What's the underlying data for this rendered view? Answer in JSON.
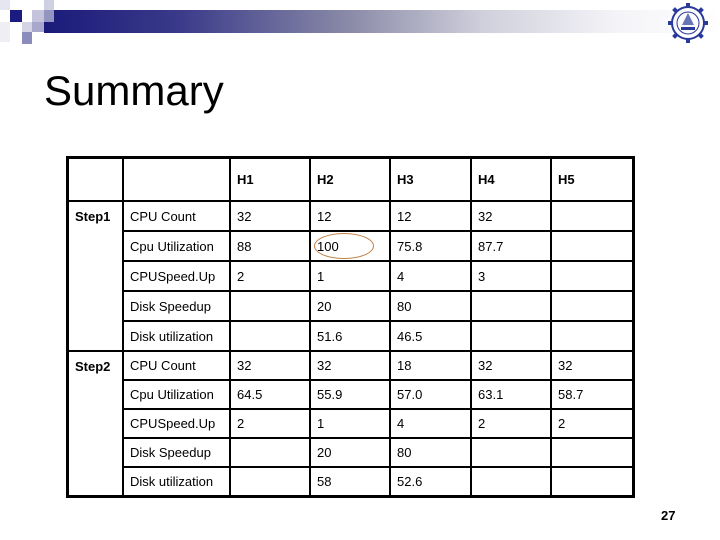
{
  "slide": {
    "title": "Summary",
    "page_number": "27",
    "logo": "institute-emblem-icon",
    "accent_color": "#1a1a7a"
  },
  "table": {
    "headers": [
      "",
      "",
      "H1",
      "H2",
      "H3",
      "H4",
      "H5"
    ],
    "groups": [
      {
        "label": "Step1",
        "rows": [
          {
            "metric": "CPU Count",
            "values": [
              "32",
              "12",
              "12",
              "32",
              ""
            ]
          },
          {
            "metric": "Cpu Utilization",
            "values": [
              "88",
              "100",
              "75.8",
              "87.7",
              ""
            ],
            "highlighted": "H2"
          },
          {
            "metric": "CPUSpeed.Up",
            "values": [
              "2",
              "1",
              "4",
              "3",
              ""
            ]
          },
          {
            "metric": "Disk Speedup",
            "values": [
              "",
              "20",
              "80",
              "",
              ""
            ]
          },
          {
            "metric": "Disk utilization",
            "values": [
              "",
              "51.6",
              "46.5",
              "",
              ""
            ]
          }
        ]
      },
      {
        "label": "Step2",
        "rows": [
          {
            "metric": "CPU Count",
            "values": [
              "32",
              "32",
              "18",
              "32",
              "32"
            ]
          },
          {
            "metric": "Cpu Utilization",
            "values": [
              "64.5",
              "55.9",
              "57.0",
              "63.1",
              "58.7"
            ]
          },
          {
            "metric": "CPUSpeed.Up",
            "values": [
              "2",
              "1",
              "4",
              "2",
              "2"
            ]
          },
          {
            "metric": "Disk Speedup",
            "values": [
              "",
              "20",
              "80",
              "",
              ""
            ]
          },
          {
            "metric": "Disk utilization",
            "values": [
              "",
              "58",
              "52.6",
              "",
              ""
            ]
          }
        ]
      }
    ]
  }
}
